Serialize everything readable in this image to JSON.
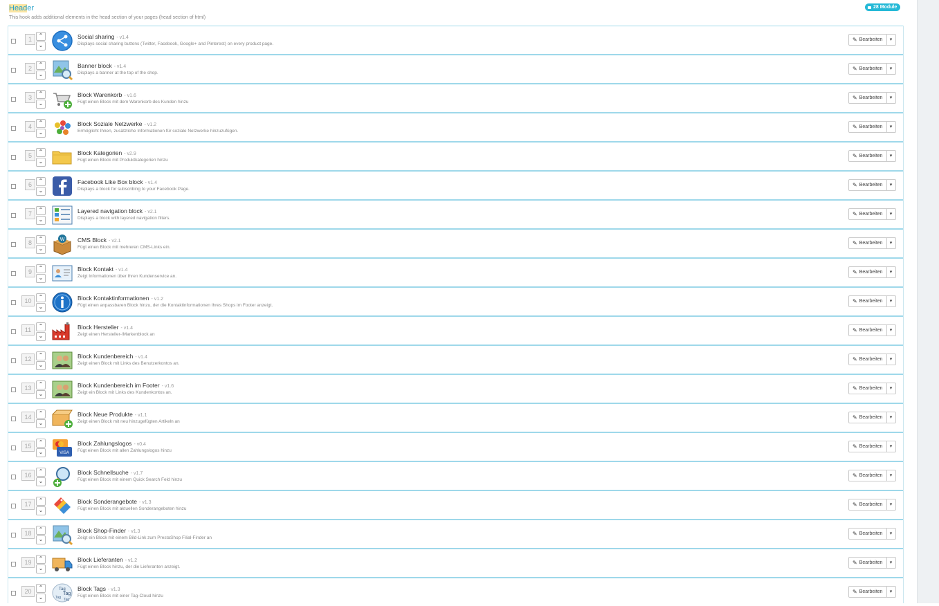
{
  "hook": {
    "title_highlight": "Head",
    "title_rest": "er",
    "description": "This hook adds additional elements in the head section of your pages (head section of html)",
    "badge": "28 Module"
  },
  "edit_label": "Bearbeiten",
  "modules": [
    {
      "pos": "1",
      "name": "Social sharing",
      "version": "- v1.4",
      "desc": "Displays social sharing buttons (Twitter, Facebook, Google+ and Pinterest) on every product page.",
      "icon": "share-icon"
    },
    {
      "pos": "2",
      "name": "Banner block",
      "version": "- v1.4",
      "desc": "Displays a banner at the top of the shop.",
      "icon": "banner-icon"
    },
    {
      "pos": "3",
      "name": "Block Warenkorb",
      "version": "- v1.6",
      "desc": "Fügt einen Block mit dem Warenkorb des Kunden hinzu",
      "icon": "cart-icon"
    },
    {
      "pos": "4",
      "name": "Block Soziale Netzwerke",
      "version": "- v1.2",
      "desc": "Ermöglicht Ihnen, zusätzliche Informationen für soziale Netzwerke hinzuzufügen.",
      "icon": "social-network-icon"
    },
    {
      "pos": "5",
      "name": "Block Kategorien",
      "version": "- v2.9",
      "desc": "Fügt einen Block mit Produktkategorien hinzu",
      "icon": "folder-icon"
    },
    {
      "pos": "6",
      "name": "Facebook Like Box block",
      "version": "- v1.4",
      "desc": "Displays a block for subscribing to your Facebook Page.",
      "icon": "facebook-icon"
    },
    {
      "pos": "7",
      "name": "Layered navigation block",
      "version": "- v2.1",
      "desc": "Displays a block with layered navigation filters.",
      "icon": "layered-navigation-icon"
    },
    {
      "pos": "8",
      "name": "CMS Block",
      "version": "- v2.1",
      "desc": "Fügt einen Block mit mehreren CMS-Links ein.",
      "icon": "cms-box-icon"
    },
    {
      "pos": "9",
      "name": "Block Kontakt",
      "version": "- v1.4",
      "desc": "Zeigt Informationen über Ihren Kundenservice an.",
      "icon": "contact-card-icon"
    },
    {
      "pos": "10",
      "name": "Block Kontaktinformationen",
      "version": "- v1.2",
      "desc": "Fügt einen anpassbaren Block hinzu, der die Kontaktinformationen Ihres Shops im Footer anzeigt.",
      "icon": "info-icon"
    },
    {
      "pos": "11",
      "name": "Block Hersteller",
      "version": "- v1.4",
      "desc": "Zeigt einen Hersteller-/Markenblock an",
      "icon": "factory-icon"
    },
    {
      "pos": "12",
      "name": "Block Kundenbereich",
      "version": "- v1.4",
      "desc": "Zeigt einen Block mit Links des Benutzerkontos an.",
      "icon": "customers-icon"
    },
    {
      "pos": "13",
      "name": "Block Kundenbereich im Footer",
      "version": "- v1.6",
      "desc": "Zeigt ein Block mit Links des Kundenkontos an.",
      "icon": "customers-icon"
    },
    {
      "pos": "14",
      "name": "Block Neue Produkte",
      "version": "- v1.1",
      "desc": "Zeigt einen Block mit neu hinzugefügten Artikeln an",
      "icon": "new-product-box-icon"
    },
    {
      "pos": "15",
      "name": "Block Zahlungslogos",
      "version": "- v0.4",
      "desc": "Fügt einen Block mit allen Zahlungslogos hinzu",
      "icon": "payment-cards-icon"
    },
    {
      "pos": "16",
      "name": "Block Schnellsuche",
      "version": "- v1.7",
      "desc": "Fügt einen Block mit einem Quick Search Feld hinzu",
      "icon": "search-add-icon"
    },
    {
      "pos": "17",
      "name": "Block Sonderangebote",
      "version": "- v1.3",
      "desc": "Fügt einen Block mit aktuellen Sonderangeboten hinzu",
      "icon": "tags-colorful-icon"
    },
    {
      "pos": "18",
      "name": "Block Shop-Finder",
      "version": "- v1.3",
      "desc": "Zeigt ein Block mit einem Bild-Link zum PrestaShop Filial-Finder an",
      "icon": "map-search-icon"
    },
    {
      "pos": "19",
      "name": "Block Lieferanten",
      "version": "- v1.2",
      "desc": "Fügt einen Block hinzu, der die Lieferanten anzeigt.",
      "icon": "truck-icon"
    },
    {
      "pos": "20",
      "name": "Block Tags",
      "version": "- v1.3",
      "desc": "Fügt einen Block mit einer Tag-Cloud hinzu",
      "icon": "tag-cloud-icon"
    }
  ]
}
